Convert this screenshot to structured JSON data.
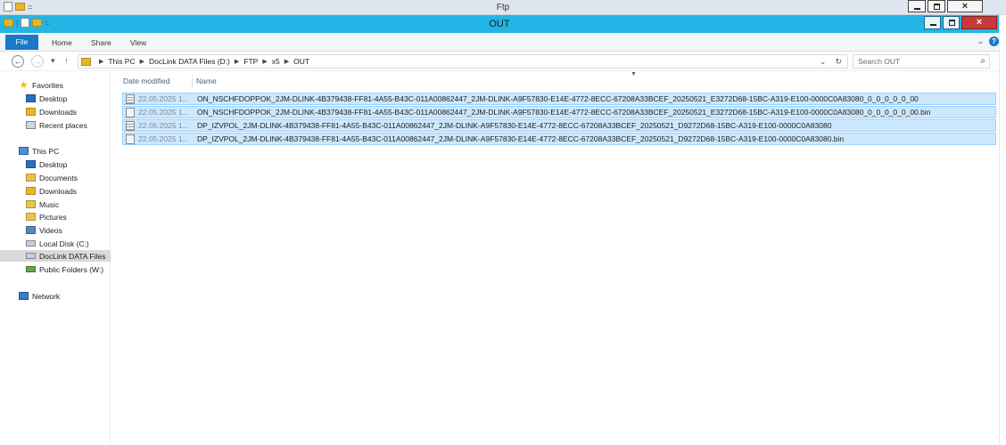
{
  "outer_window": {
    "title": "Ftp"
  },
  "window": {
    "title": "OUT"
  },
  "ribbon": {
    "file": "File",
    "tabs": [
      "Home",
      "Share",
      "View"
    ]
  },
  "address": {
    "crumbs": [
      "This PC",
      "DocLink DATA Files (D:)",
      "FTP",
      "x5",
      "OUT"
    ],
    "dropdown_glyph": "⌄",
    "refresh_glyph": "↻"
  },
  "search": {
    "placeholder": "Search OUT"
  },
  "nav": {
    "favorites": "Favorites",
    "desktop": "Desktop",
    "downloads": "Downloads",
    "recent": "Recent places",
    "this_pc": "This PC",
    "pc_desktop": "Desktop",
    "documents": "Documents",
    "pc_downloads": "Downloads",
    "music": "Music",
    "pictures": "Pictures",
    "videos": "Videos",
    "local_disk": "Local Disk (C:)",
    "doclink": "DocLink DATA Files",
    "public": "Public Folders (W:)",
    "network": "Network"
  },
  "columns": {
    "date": "Date modified",
    "name": "Name"
  },
  "files": [
    {
      "date": "22.05.2025 1...",
      "name": "ON_NSCHFDOPPOK_2JM-DLINK-4B379438-FF81-4A55-B43C-011A00862447_2JM-DLINK-A9F57830-E14E-4772-8ECC-67208A33BCEF_20250521_E3272D68-15BC-A319-E100-0000C0A83080_0_0_0_0_0_00",
      "icon": "text-file-icon"
    },
    {
      "date": "22.05.2025 1...",
      "name": "ON_NSCHFDOPPOK_2JM-DLINK-4B379438-FF81-4A55-B43C-011A00862447_2JM-DLINK-A9F57830-E14E-4772-8ECC-67208A33BCEF_20250521_E3272D68-15BC-A319-E100-0000C0A83080_0_0_0_0_0_00.bin",
      "icon": "file-icon"
    },
    {
      "date": "22.05.2025 1...",
      "name": "DP_IZVPOL_2JM-DLINK-4B379438-FF81-4A55-B43C-011A00862447_2JM-DLINK-A9F57830-E14E-4772-8ECC-67208A33BCEF_20250521_D9272D68-15BC-A319-E100-0000C0A83080",
      "icon": "text-file-icon"
    },
    {
      "date": "22.05.2025 1...",
      "name": "DP_IZVPOL_2JM-DLINK-4B379438-FF81-4A55-B43C-011A00862447_2JM-DLINK-A9F57830-E14E-4772-8ECC-67208A33BCEF_20250521_D9272D68-15BC-A319-E100-0000C0A83080.bin",
      "icon": "file-icon"
    }
  ],
  "colors": {
    "title_bar": "#23b5e6",
    "file_tab": "#1979ca",
    "selection": "#cce8ff",
    "selection_border": "#99d1ff",
    "close_button": "#c7393a"
  }
}
